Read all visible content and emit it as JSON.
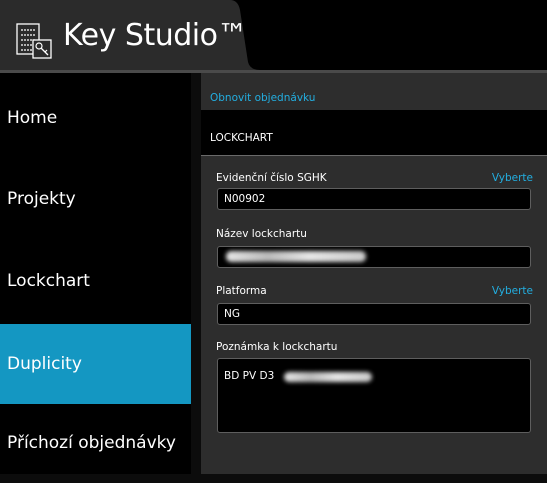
{
  "header": {
    "app_title": "Key Studio™",
    "logo_icon": "keys-document-icon"
  },
  "sidebar": {
    "items": [
      {
        "label": "Home",
        "active": false
      },
      {
        "label": "Projekty",
        "active": false
      },
      {
        "label": "Lockchart",
        "active": false
      },
      {
        "label": "Duplicity",
        "active": true
      },
      {
        "label": "Příchozí objednávky",
        "active": false
      }
    ]
  },
  "main": {
    "refresh_link": "Obnovit objednávku",
    "section_title": "LOCKCHART",
    "fields": {
      "sghk": {
        "label": "Evidenční číslo SGHK",
        "action": "Vyberte",
        "value": "N00902"
      },
      "name": {
        "label": "Název lockchartu",
        "value": ""
      },
      "platform": {
        "label": "Platforma",
        "action": "Vyberte",
        "value": "NG"
      },
      "note": {
        "label": "Poznámka k lockchartu",
        "value": "BD PV D3"
      }
    }
  },
  "colors": {
    "accent": "#1497c2",
    "link": "#23aee0",
    "panel": "#2d2d2d",
    "background": "#000000"
  }
}
